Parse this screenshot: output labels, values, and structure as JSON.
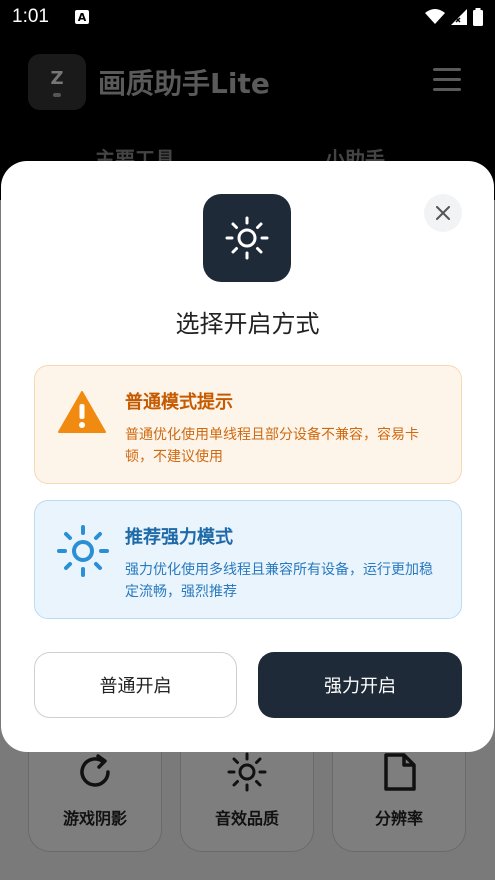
{
  "status_bar": {
    "time": "1:01",
    "notification_icon": "A"
  },
  "app": {
    "logo_letter": "Z",
    "title": "画质助手Lite",
    "tabs": [
      "主要工具",
      "小助手"
    ]
  },
  "tools": [
    {
      "label": "游戏阴影",
      "icon": "refresh-icon"
    },
    {
      "label": "音效品质",
      "icon": "sun-icon"
    },
    {
      "label": "分辨率",
      "icon": "file-icon"
    }
  ],
  "dialog": {
    "title": "选择开启方式",
    "options": [
      {
        "title": "普通模式提示",
        "desc": "普通优化使用单线程且部分设备不兼容，容易卡顿，不建议使用",
        "icon": "warning-icon",
        "color": "#f08a10"
      },
      {
        "title": "推荐强力模式",
        "desc": "强力优化使用多线程且兼容所有设备，运行更加稳定流畅，强烈推荐",
        "icon": "sun-icon",
        "color": "#2b8fd6"
      }
    ],
    "buttons": {
      "normal": "普通开启",
      "strong": "强力开启"
    },
    "accent": "#1f2a38"
  }
}
